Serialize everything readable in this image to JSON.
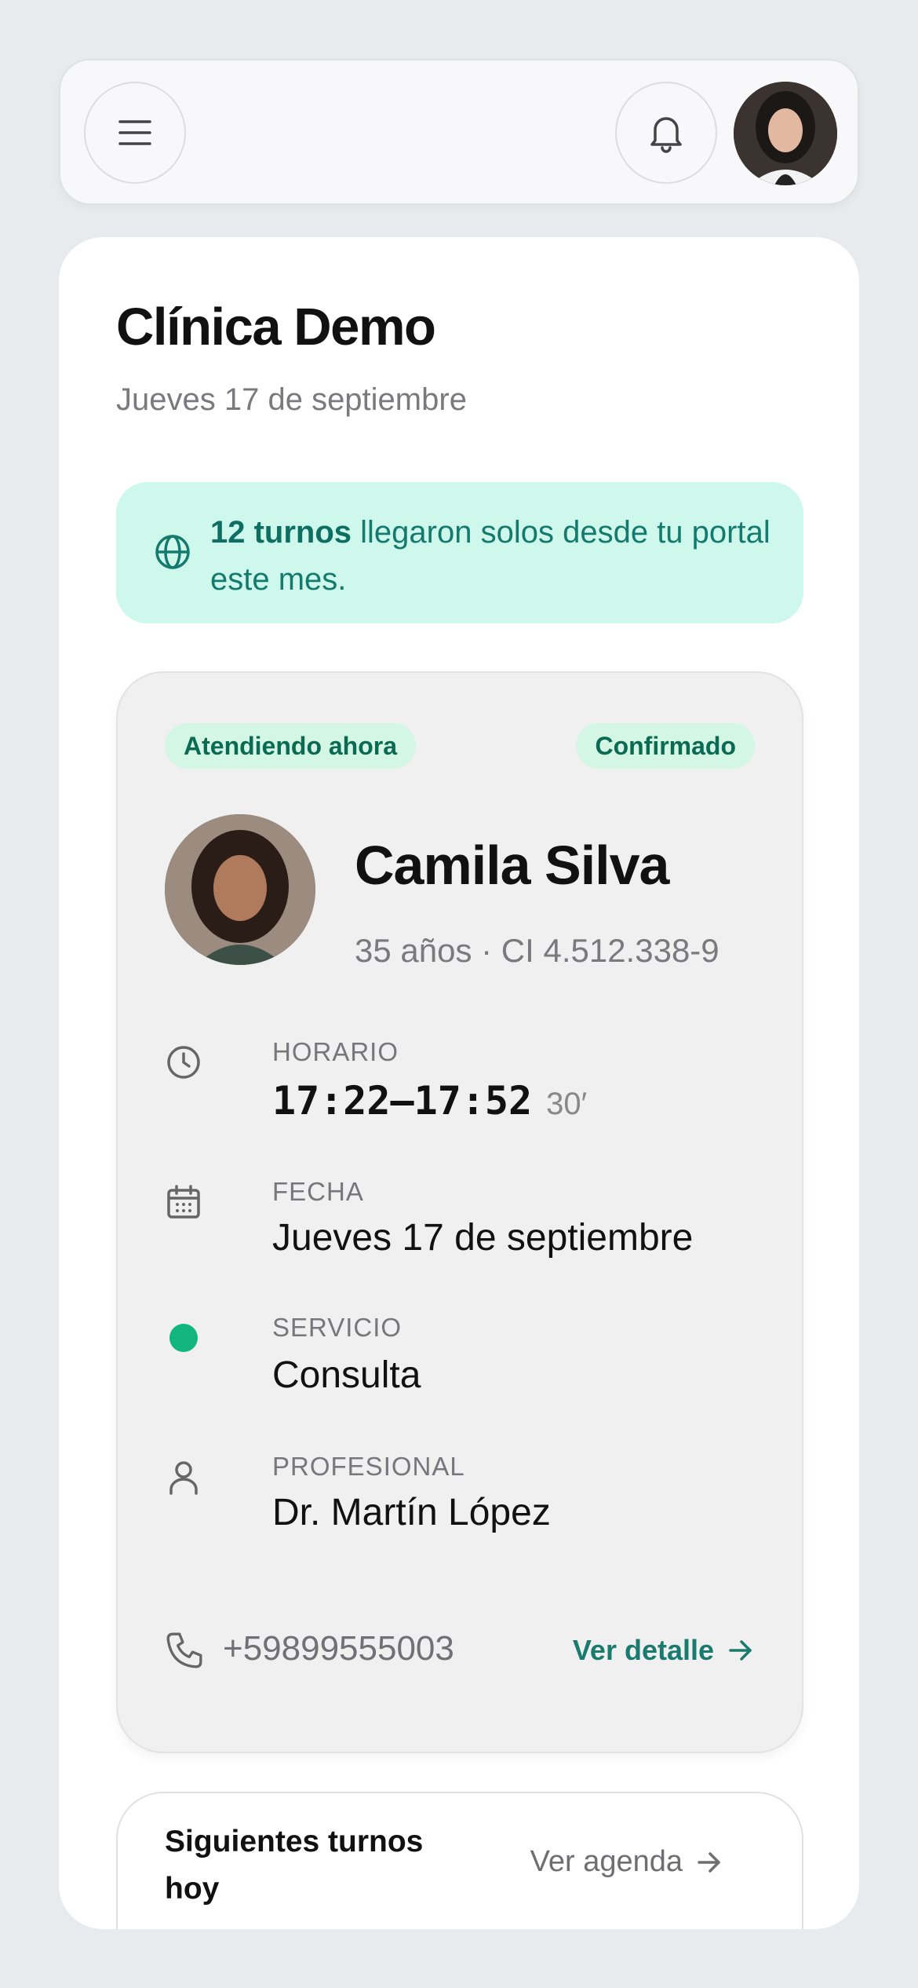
{
  "header": {
    "menu_icon": "menu-icon",
    "bell_icon": "bell-icon",
    "avatar": "user-avatar"
  },
  "clinic": {
    "title": "Clínica Demo",
    "date": "Jueves 17 de septiembre"
  },
  "banner": {
    "icon": "globe-icon",
    "count": "12 turnos",
    "text": " llegaron solos desde tu portal este mes."
  },
  "appointment": {
    "status_now": "Atendiendo ahora",
    "status_confirmed": "Confirmado",
    "patient_name": "Camila Silva",
    "patient_meta": "35 años · CI 4.512.338-9",
    "schedule_label": "HORARIO",
    "schedule_value": "17:22–17:52",
    "duration": "30′",
    "date_label": "FECHA",
    "date_value": "Jueves 17 de septiembre",
    "service_label": "SERVICIO",
    "service_value": "Consulta",
    "service_color": "#12b57e",
    "professional_label": "PROFESIONAL",
    "professional_value": "Dr. Martín López",
    "phone": "+59899555003",
    "detail_link": "Ver detalle"
  },
  "next": {
    "title": "Siguientes turnos hoy",
    "agenda_link": "Ver agenda"
  },
  "colors": {
    "accent": "#1a7a6e",
    "banner_bg": "#cff8ec",
    "pill_bg": "#d3f6e5"
  }
}
